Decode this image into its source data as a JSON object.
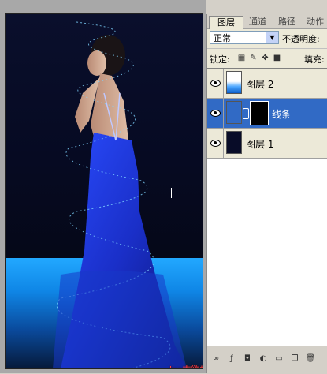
{
  "panel_tabs": [
    "图层",
    "通道",
    "路径",
    "动作"
  ],
  "blend_mode": "正常",
  "opacity_label": "不透明度:",
  "lock_label": "锁定:",
  "fill_label": "填充:",
  "layers": [
    {
      "name": "图层 2",
      "selected": false
    },
    {
      "name": "线条",
      "selected": true
    },
    {
      "name": "图层 1",
      "selected": false
    }
  ],
  "watermark": "by:古欲香萧·艾瀑群 55199439",
  "icons": [
    "eye-icon",
    "link-icon",
    "lock-transparency-icon",
    "brush-icon",
    "move-icon",
    "lock-icon",
    "dropdown-arrow-icon"
  ]
}
